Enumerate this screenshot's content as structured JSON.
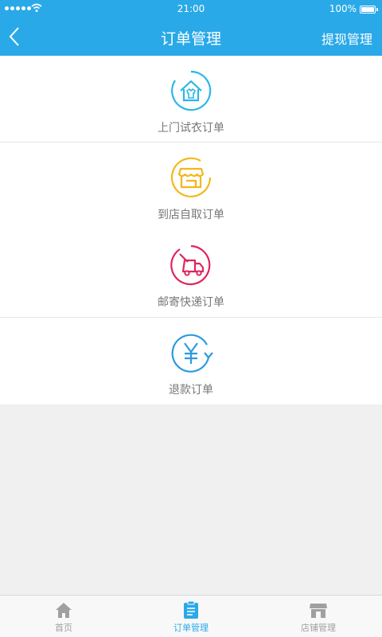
{
  "status": {
    "time": "21:00",
    "battery": "100%"
  },
  "header": {
    "title": "订单管理",
    "right_action": "提现管理"
  },
  "orders": [
    {
      "label": "上门试衣订单",
      "icon": "home-shirt-icon",
      "color": "#29b6e8"
    },
    {
      "label": "到店自取订单",
      "icon": "store-icon",
      "color": "#f3b71a"
    },
    {
      "label": "邮寄快递订单",
      "icon": "delivery-truck-icon",
      "color": "#e0245e"
    },
    {
      "label": "退款订单",
      "icon": "refund-yen-icon",
      "color": "#2c9be0"
    }
  ],
  "tabs": [
    {
      "label": "首页",
      "icon": "home-icon",
      "active": false
    },
    {
      "label": "订单管理",
      "icon": "clipboard-icon",
      "active": true
    },
    {
      "label": "店铺管理",
      "icon": "store-icon",
      "active": false
    }
  ],
  "colors": {
    "accent": "#2aa9e8",
    "tab_inactive": "#a0a0a0"
  }
}
